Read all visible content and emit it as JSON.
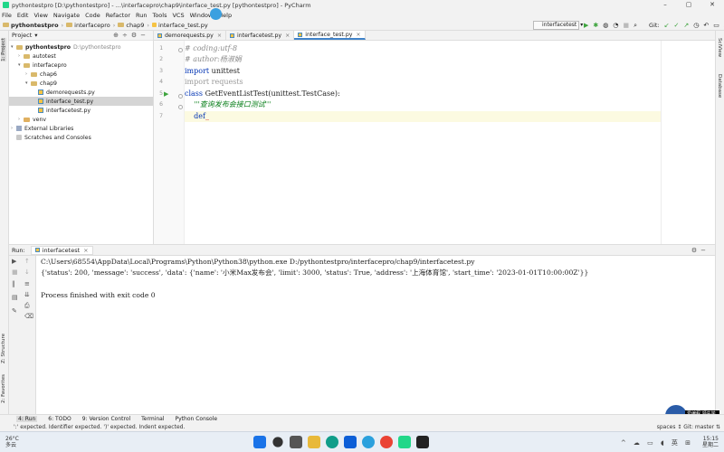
{
  "window": {
    "title": "pythontestpro [D:\\pythontestpro] - ...\\interfacepro\\chap9\\interface_test.py [pythontestpro] - PyCharm",
    "minimize": "–",
    "maximize": "▢",
    "close": "✕"
  },
  "menu": [
    "File",
    "Edit",
    "View",
    "Navigate",
    "Code",
    "Refactor",
    "Run",
    "Tools",
    "VCS",
    "Window",
    "Help"
  ],
  "breadcrumb": [
    "pythontestpro",
    "interfacepro",
    "chap9",
    "interface_test.py"
  ],
  "run_config": "interfacetest",
  "git": {
    "label": "Git:"
  },
  "sidebar_tabs": {
    "project": "1: Project",
    "structure": "Z: Structure",
    "favorites": "2: Favorites"
  },
  "right_tabs": {
    "sciview": "SciView",
    "database": "Database"
  },
  "project": {
    "header": "Project",
    "items": [
      {
        "label": "pythontestpro",
        "note": "D:\\pythontestpro"
      },
      {
        "label": "autotest"
      },
      {
        "label": "interfacepro"
      },
      {
        "label": "chap6"
      },
      {
        "label": "chap9"
      },
      {
        "label": "demorequests.py"
      },
      {
        "label": "interface_test.py"
      },
      {
        "label": "interfacetest.py"
      },
      {
        "label": "venv"
      },
      {
        "label": "External Libraries"
      },
      {
        "label": "Scratches and Consoles"
      }
    ]
  },
  "editor": {
    "tabs": [
      {
        "label": "demorequests.py"
      },
      {
        "label": "interfacetest.py"
      },
      {
        "label": "interface_test.py"
      }
    ],
    "lines": [
      {
        "n": "1",
        "text": "# coding:utf-8"
      },
      {
        "n": "2",
        "text": "# author:杨淑娟"
      },
      {
        "n": "3",
        "kw": "import",
        "rest": " unittest"
      },
      {
        "n": "4",
        "kw": "import",
        "rest": " requests"
      },
      {
        "n": "5",
        "kw": "class",
        "rest": " GetEventListTest(unittest.TestCase):"
      },
      {
        "n": "6",
        "text": "    '''查询发布会接口测试'''"
      },
      {
        "n": "7",
        "kw": "    def",
        "rest": "_"
      }
    ]
  },
  "run": {
    "label": "Run:",
    "tab": "interfacetest",
    "console": [
      "C:\\Users\\68554\\AppData\\Local\\Programs\\Python\\Python38\\python.exe D:/pythontestpro/interfacepro/chap9/interfacetest.py",
      "{'status': 200, 'message': 'success', 'data': {'name': '小米Max发布会', 'limit': 3000, 'status': True, 'address': '上海体育馆', 'start_time': '2023-01-01T10:00:00Z'}}",
      "",
      "Process finished with exit code 0"
    ]
  },
  "tool_windows": [
    "4: Run",
    "6: TODO",
    "9: Version Control",
    "Terminal",
    "Python Console"
  ],
  "status": {
    "message": "':' expected. Identifier expected. ')' expected. Indent expected.",
    "right": "spaces ↕  Git: master ⇅"
  },
  "ime": {
    "s": "S",
    "lang": "英"
  },
  "badge": "爱编程 领先学习",
  "taskbar": {
    "weather_temp": "26°C",
    "weather_desc": "多云",
    "time": "15:15",
    "day": "星期二"
  }
}
